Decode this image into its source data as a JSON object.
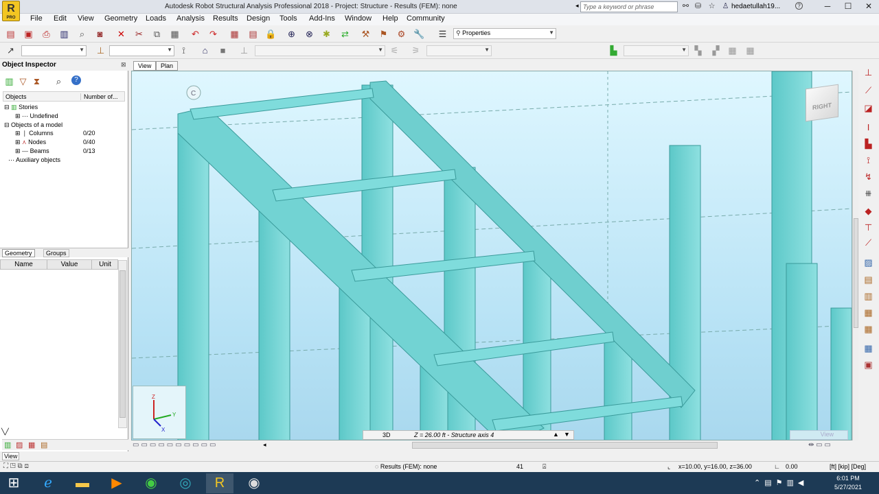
{
  "titlebar": {
    "doc_title": "Autodesk Robot Structural Analysis Professional 2018 - Project: Structure - Results (FEM): none",
    "search_placeholder": "Type a keyword or phrase",
    "user": "hedaetullah19...",
    "logo": "R",
    "logo_sub": "PRO"
  },
  "menu": [
    "File",
    "Edit",
    "View",
    "Geometry",
    "Loads",
    "Analysis",
    "Results",
    "Design",
    "Tools",
    "Add-Ins",
    "Window",
    "Help",
    "Community"
  ],
  "toolbar": {
    "properties_label": "Properties"
  },
  "object_inspector": {
    "title": "Object Inspector",
    "col_objects": "Objects",
    "col_number": "Number of...",
    "tree": [
      {
        "label": "Stories",
        "count": ""
      },
      {
        "label": "Undefined",
        "count": ""
      },
      {
        "label": "Objects of a model",
        "count": ""
      },
      {
        "label": "Columns",
        "count": "0/20"
      },
      {
        "label": "Nodes",
        "count": "0/40"
      },
      {
        "label": "Beams",
        "count": "0/13"
      },
      {
        "label": "Auxiliary objects",
        "count": ""
      }
    ],
    "tab_geometry": "Geometry",
    "tab_groups": "Groups",
    "prop_name": "Name",
    "prop_value": "Value",
    "prop_unit": "Unit"
  },
  "view_tabs": [
    "View",
    "Plan"
  ],
  "viewport": {
    "axis_label": "C",
    "viewcube_label": "RIGHT",
    "view_mode": "3D",
    "level": "Z = 26.00 ft - Structure axis 4",
    "corner_label": "View"
  },
  "left_bottom_label": "View",
  "status": {
    "results": "Results (FEM): none",
    "num": "41",
    "coords": "x=10.00, y=16.00, z=36.00",
    "value": "0.00",
    "units": "[ft] [kip] [Deg]"
  },
  "clock": {
    "time": "6:01 PM",
    "date": "5/27/2021"
  }
}
